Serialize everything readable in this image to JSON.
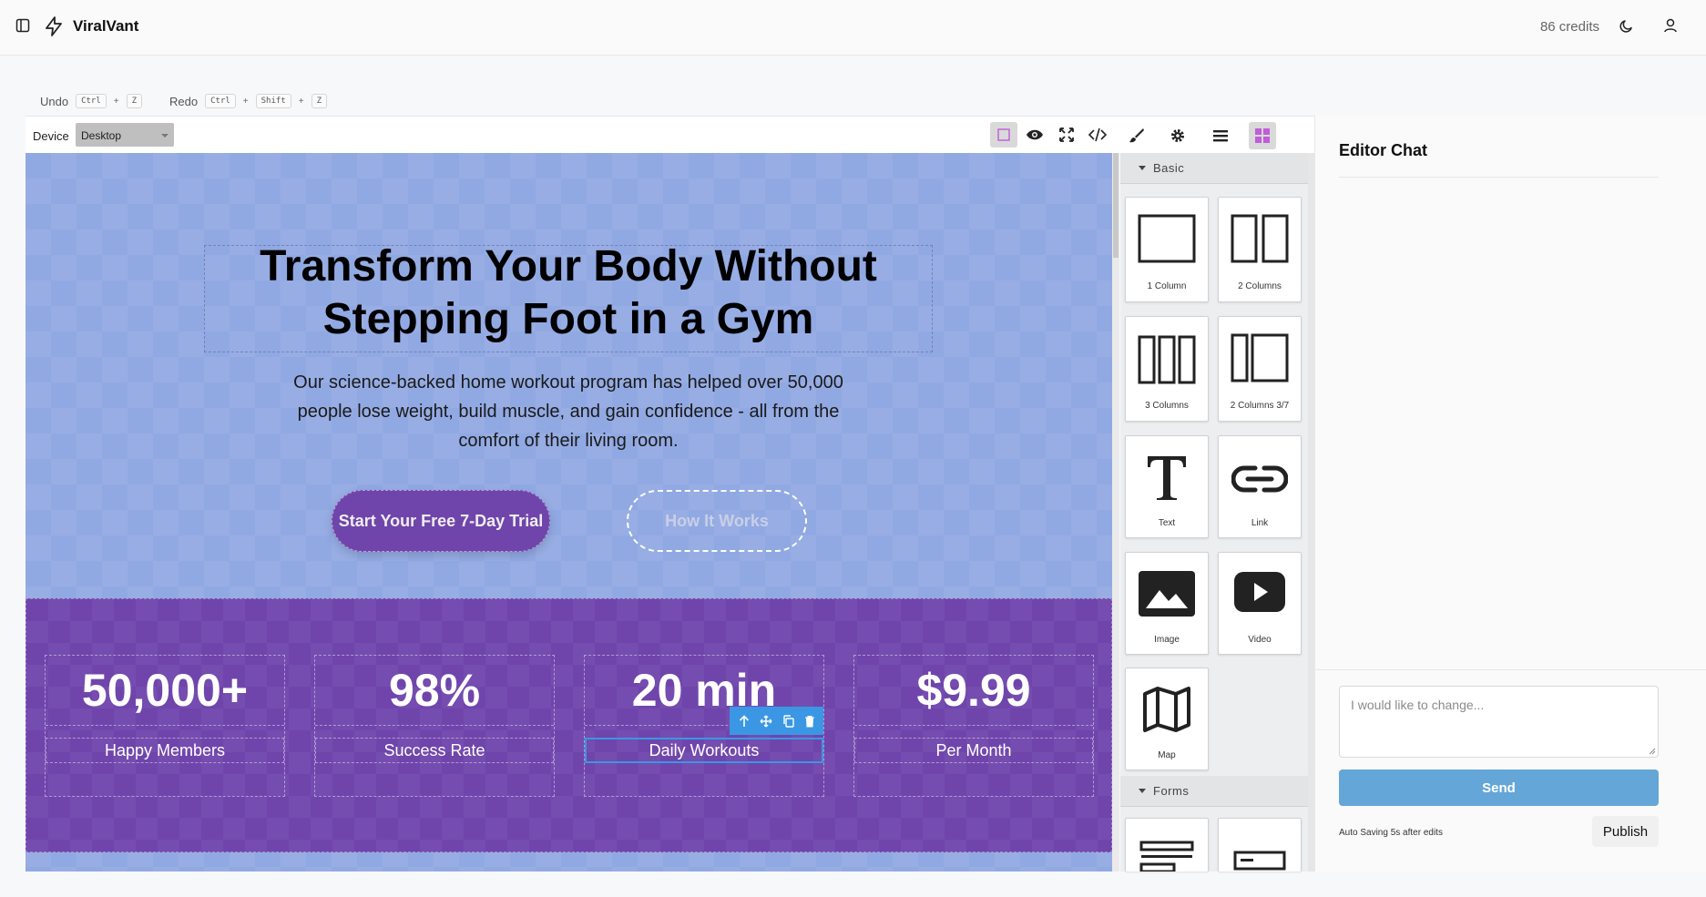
{
  "app": {
    "title": "ViralVant",
    "credits": "86 credits"
  },
  "history": {
    "undo_label": "Undo",
    "undo_keys": [
      "Ctrl",
      "Z"
    ],
    "redo_label": "Redo",
    "redo_keys": [
      "Ctrl",
      "Shift",
      "Z"
    ]
  },
  "device": {
    "label": "Device",
    "value": "Desktop"
  },
  "toolbar": [
    "sw-visibility-icon",
    "eye-icon",
    "fullscreen-icon",
    "code-icon"
  ],
  "hero": {
    "headline": "Transform Your Body Without Stepping Foot in a Gym",
    "subtext": "Our science-backed home workout program has helped over 50,000 people lose weight, build muscle, and gain confidence - all from the comfort of their living room.",
    "cta_primary": "Start Your Free 7-Day Trial",
    "cta_secondary": "How It Works"
  },
  "stats": [
    {
      "value": "50,000+",
      "label": "Happy Members"
    },
    {
      "value": "98%",
      "label": "Success Rate"
    },
    {
      "value": "20 min",
      "label": "Daily Workouts"
    },
    {
      "value": "$9.99",
      "label": "Per Month"
    }
  ],
  "blocks_panel": {
    "categories": [
      "Basic",
      "Forms"
    ],
    "basic_blocks": [
      "1 Column",
      "2 Columns",
      "3 Columns",
      "2 Columns 3/7",
      "Text",
      "Link",
      "Image",
      "Video",
      "Map"
    ]
  },
  "chat": {
    "title": "Editor Chat",
    "input_placeholder": "I would like to change...",
    "send_label": "Send",
    "autosave_text": "Auto Saving 5s after edits",
    "publish_label": "Publish"
  },
  "colors": {
    "hero_bg": "#91a9e3",
    "stats_bg": "#6f45ac",
    "cta_bg": "#7045ab",
    "send_bg": "#64a6d8",
    "select_blue": "#3b97e3"
  }
}
